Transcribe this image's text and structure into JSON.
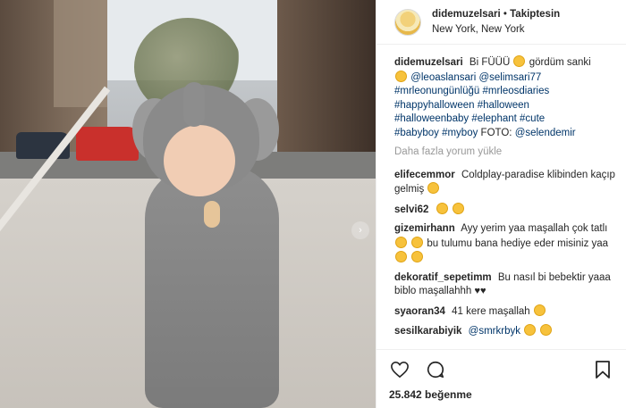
{
  "post": {
    "username": "didemuzelsari",
    "follow_separator": "•",
    "follow_status": "Takiptesin",
    "location": "New York, New York"
  },
  "caption": {
    "username": "didemuzelsari",
    "text_start": "Bi FÜÜÜ",
    "text_mid": "gördüm sanki",
    "mentions": [
      "@leoaslansari",
      "@selimsari77"
    ],
    "hashtags_line1": "#mrleonungünlüğü #mrleosdiaries",
    "hashtags_line2": "#happyhalloween #halloween",
    "hashtags_line3": "#halloweenbaby #elephant #cute",
    "hashtags_line4": "#babyboy #myboy",
    "foto_label": "FOTO:",
    "foto_credit": "@selendemir"
  },
  "load_more": "Daha fazla yorum yükle",
  "comments": [
    {
      "user": "elifecemmor",
      "text": "Coldplay-paradise klibinden kaçıp gelmiş"
    },
    {
      "user": "selvi62",
      "text": ""
    },
    {
      "user": "gizemirhann",
      "text": "Ayy yerim yaa maşallah çok tatlı",
      "text2": "bu tulumu bana hediye eder misiniz yaa"
    },
    {
      "user": "dekoratif_sepetimm",
      "text": "Bu nasıl bi bebektir yaaa biblo maşallahhh"
    },
    {
      "user": "syaoran34",
      "text": "41 kere maşallah"
    },
    {
      "user": "sesilkarabiyik",
      "text": "@smrkrbyk"
    }
  ],
  "likes": {
    "count": "25.842",
    "label": "beğenme"
  },
  "icons": {
    "heart": "heart-icon",
    "comment": "comment-icon",
    "bookmark": "bookmark-icon",
    "next": "chevron-right-icon"
  }
}
